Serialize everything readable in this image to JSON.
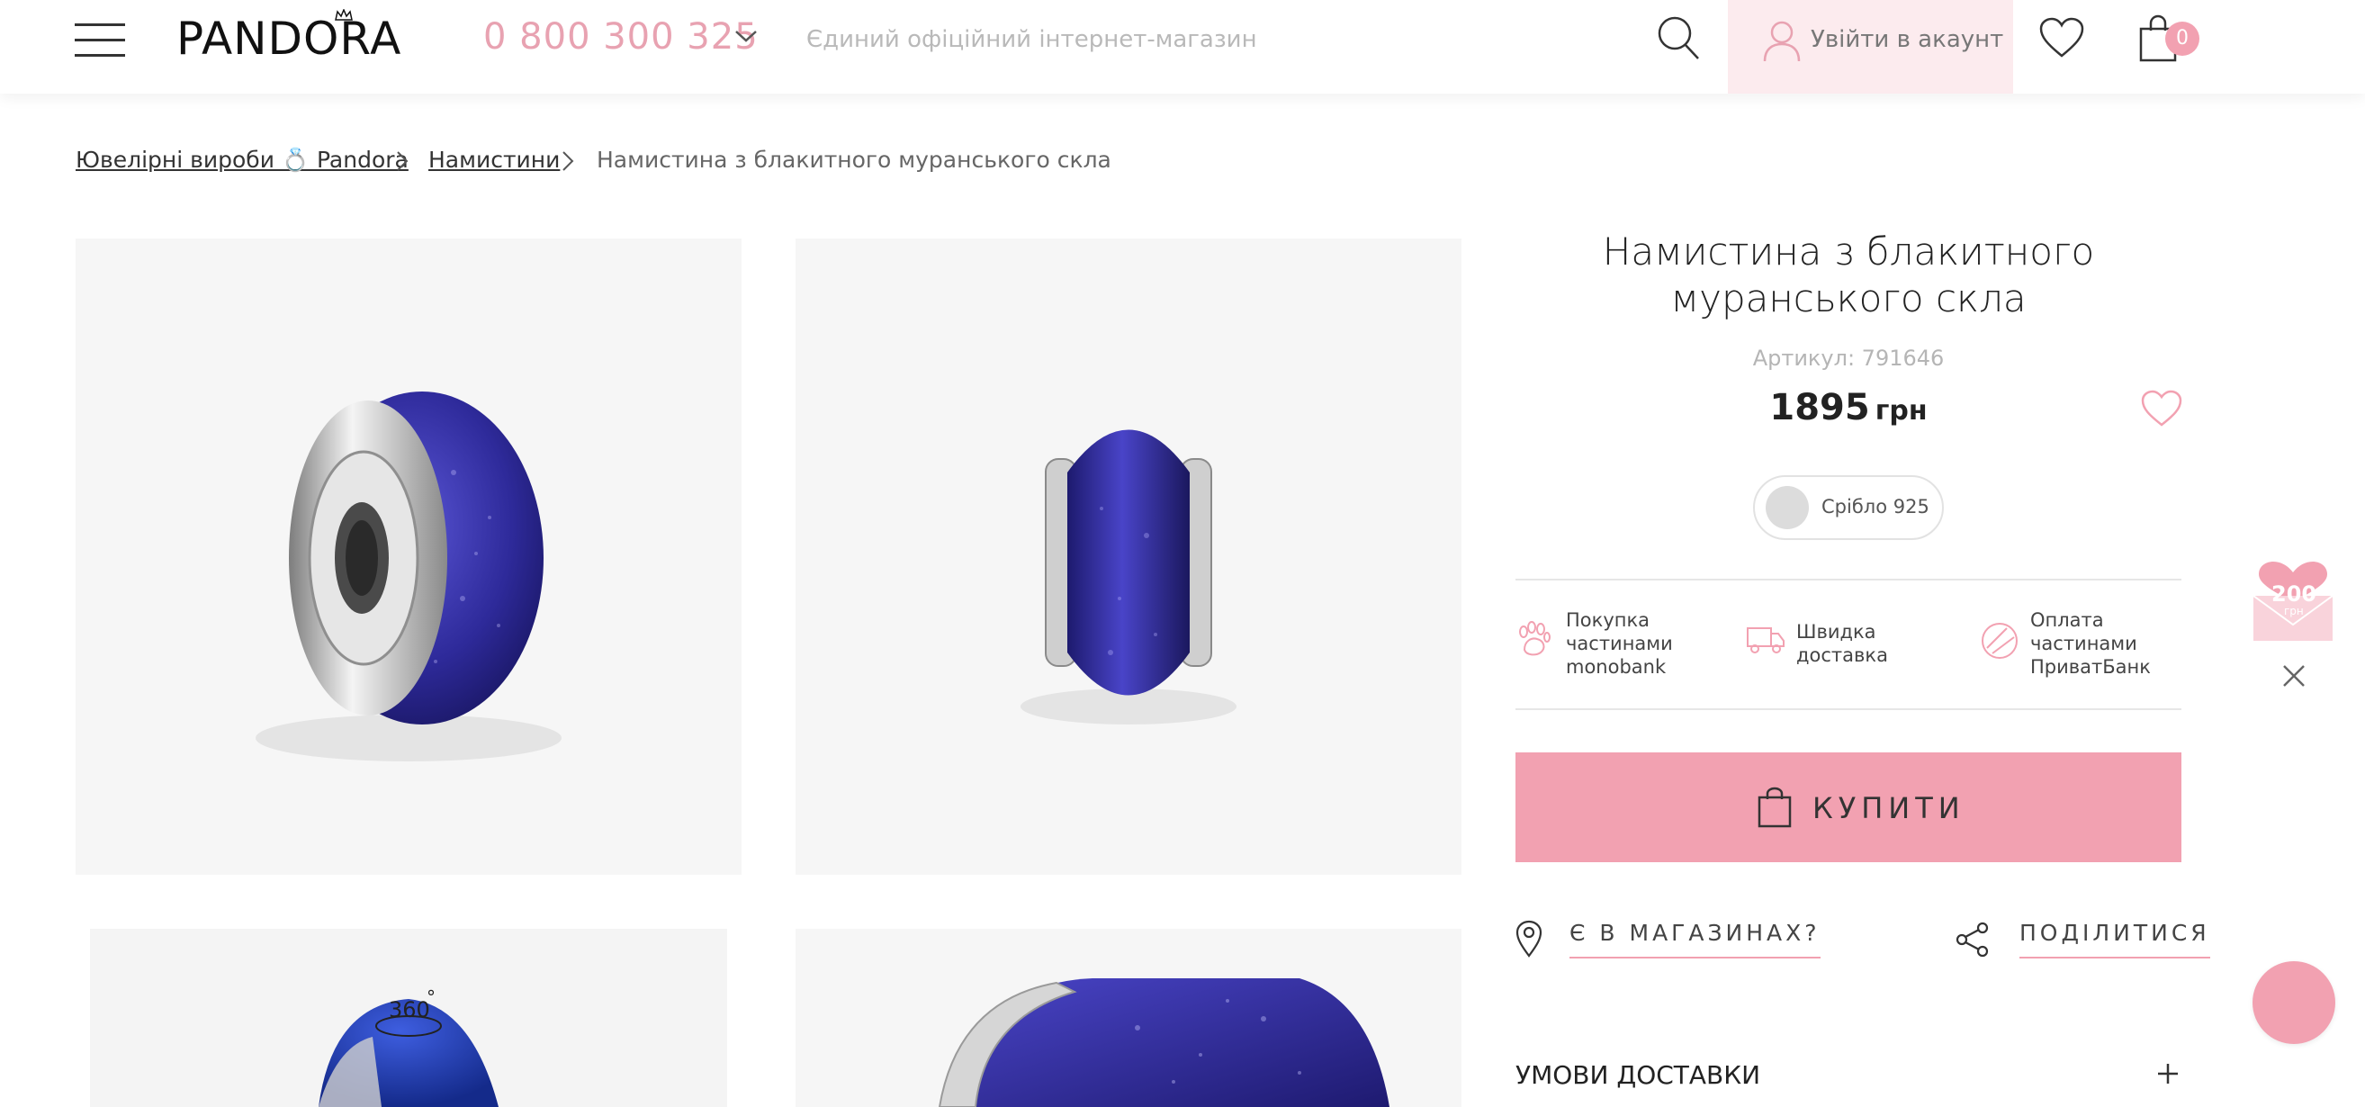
{
  "header": {
    "logo_text": "PANDORA",
    "phone": "0 800 300 325",
    "tagline": "Єдиний офіційний інтернет-магазин",
    "account_label": "Увійти в акаунт",
    "cart_count": "0",
    "accent_color": "#f2a1b1"
  },
  "breadcrumb": {
    "items": [
      "Ювелірні вироби 💍 Pandora",
      "Намистини"
    ],
    "current": "Намистина з блакитного муранського скла"
  },
  "gallery": {
    "badge_360": "360",
    "degree": "°"
  },
  "product": {
    "title_line1": "Намистина з блакитного",
    "title_line2": "муранського скла",
    "sku": "Артикул: 791646",
    "price": "1895",
    "currency": "грн",
    "metal": "Срібло 925"
  },
  "features": [
    {
      "icon": "paw-icon",
      "text": "Покупка частинами monobank"
    },
    {
      "icon": "truck-icon",
      "text": "Швидка доставка"
    },
    {
      "icon": "privatbank-icon",
      "text": "Оплата частинами ПриватБанк"
    }
  ],
  "actions": {
    "buy": "КУПИТИ",
    "in_stores": "Є В МАГАЗИНАХ?",
    "share": "ПОДІЛИТИСЯ"
  },
  "accordion": {
    "delivery": "УМОВИ ДОСТАВКИ"
  },
  "promo": {
    "amount": "200",
    "currency": "грн"
  }
}
